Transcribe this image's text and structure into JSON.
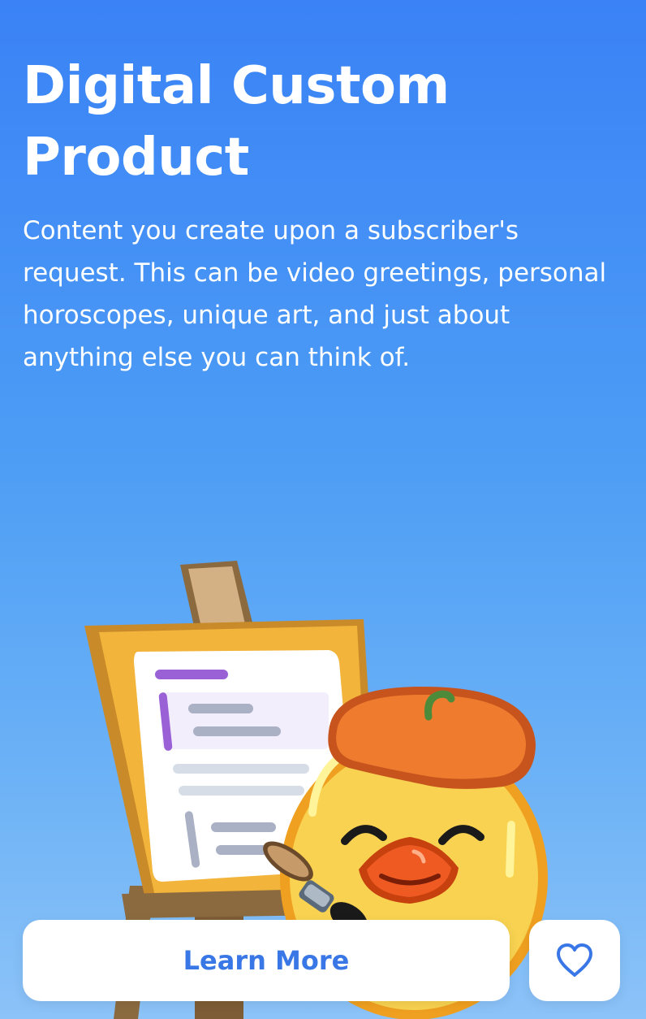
{
  "header": {
    "title": "Digital Custom Product",
    "description": "Content you create upon a subscriber's request. This can be video greetings, personal horoscopes, unique art, and just about anything else you can think of."
  },
  "illustration": {
    "icon": "duck-artist-easel-illustration"
  },
  "actions": {
    "learn_more_label": "Learn More",
    "favorite_icon": "heart-icon"
  },
  "colors": {
    "background_top": "#3a82f6",
    "background_bottom": "#8cc3f8",
    "button_text": "#3a77e6"
  }
}
